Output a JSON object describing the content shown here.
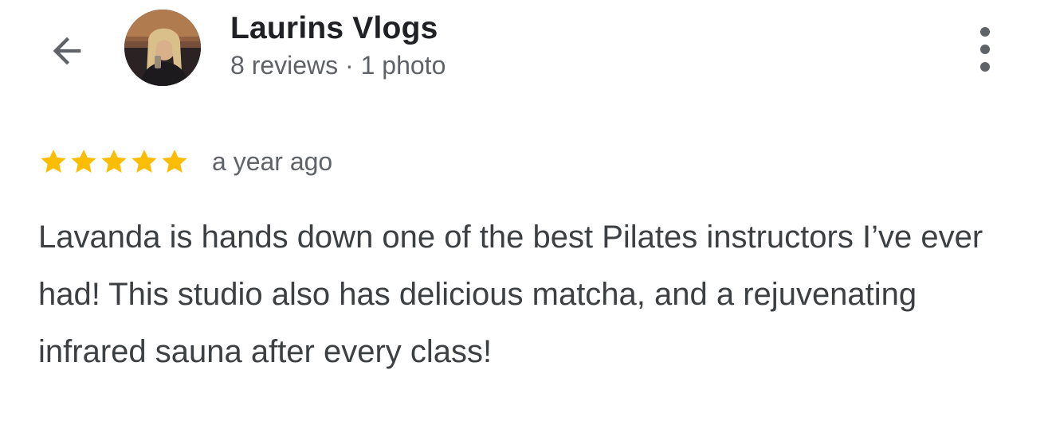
{
  "reviewer": {
    "name": "Laurins Vlogs",
    "meta": "8 reviews · 1 photo"
  },
  "icons": {
    "back": "arrow-left-icon",
    "more": "more-vert-icon",
    "star": "star-icon"
  },
  "review": {
    "rating": 5,
    "rating_max": 5,
    "time": "a year ago",
    "text": "Lavanda is hands down one of the best Pilates instructors I’ve ever had! This studio also has delicious matcha, and a rejuvenating infrared sauna after every class!"
  },
  "colors": {
    "star": "#fbbc04",
    "text": "#3c4043",
    "secondary": "#5f6368"
  }
}
